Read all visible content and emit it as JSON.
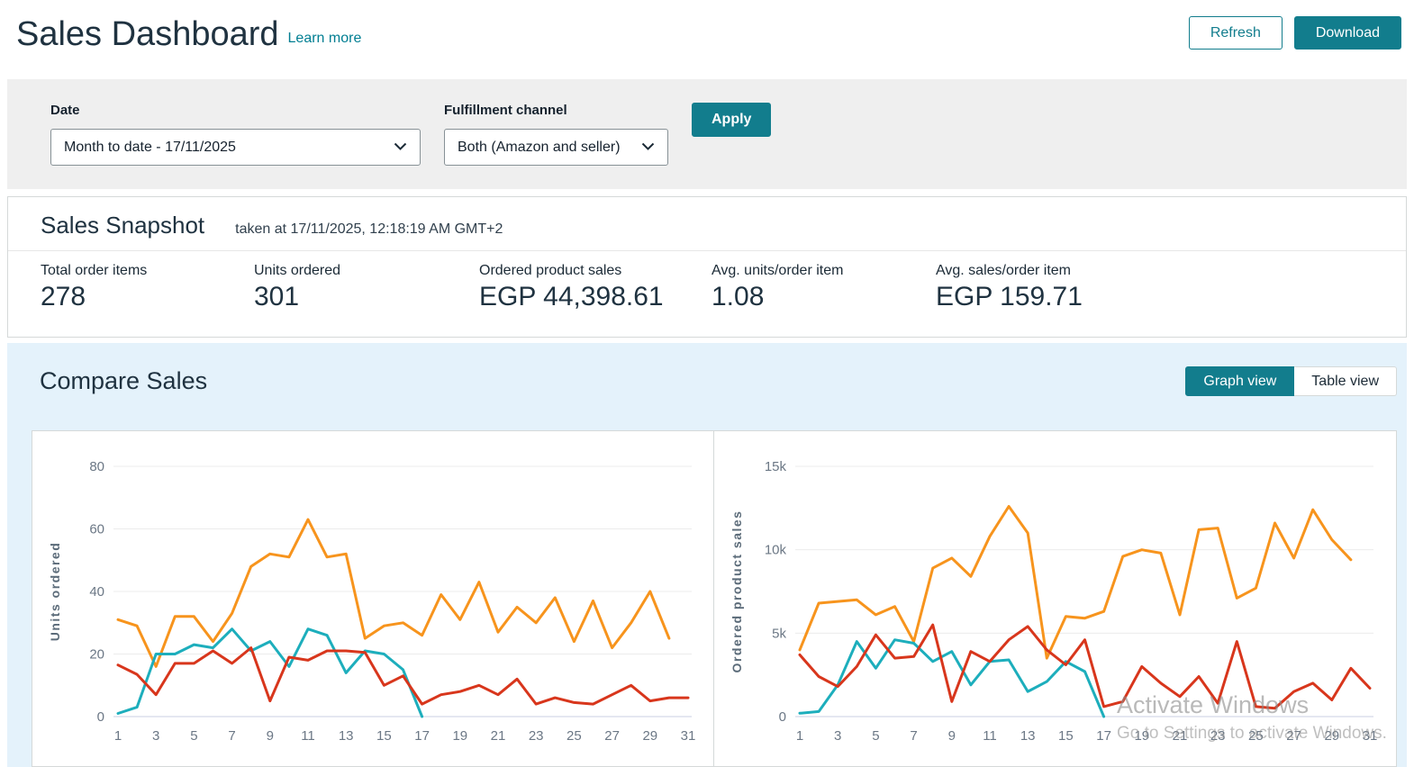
{
  "header": {
    "title": "Sales Dashboard",
    "learn_more": "Learn more",
    "refresh_label": "Refresh",
    "download_label": "Download"
  },
  "filters": {
    "date_label": "Date",
    "date_value": "Month to date - 17/11/2025",
    "channel_label": "Fulfillment channel",
    "channel_value": "Both (Amazon and seller)",
    "apply_label": "Apply"
  },
  "snapshot": {
    "title": "Sales Snapshot",
    "taken_at": "taken at 17/11/2025, 12:18:19 AM GMT+2",
    "metrics": [
      {
        "label": "Total order items",
        "value": "278"
      },
      {
        "label": "Units ordered",
        "value": "301"
      },
      {
        "label": "Ordered product sales",
        "value": "EGP 44,398.61"
      },
      {
        "label": "Avg. units/order item",
        "value": "1.08"
      },
      {
        "label": "Avg. sales/order item",
        "value": "EGP 159.71"
      }
    ]
  },
  "compare": {
    "title": "Compare Sales",
    "graph_view_label": "Graph view",
    "table_view_label": "Table view"
  },
  "watermark": {
    "line1": "Activate Windows",
    "line2": "Go to Settings to activate Windows."
  },
  "colors": {
    "accent_teal": "#127d8d",
    "link_teal": "#007e92",
    "series_orange": "#f7941d",
    "series_teal": "#1daebc",
    "series_red": "#d8361c",
    "compare_bg": "#e4f2fb",
    "filter_bar_bg": "#efefef"
  },
  "chart_data": [
    {
      "type": "line",
      "ylabel": "Units ordered",
      "ylim": [
        0,
        80
      ],
      "xlim": [
        1,
        31
      ],
      "grid": true,
      "legend": "none",
      "yticks": [
        0,
        20,
        40,
        60,
        80
      ],
      "ytick_labels": [
        "0",
        "20",
        "40",
        "60",
        "80"
      ],
      "xticks": [
        1,
        3,
        5,
        7,
        9,
        11,
        13,
        15,
        17,
        19,
        21,
        23,
        25,
        27,
        29,
        31
      ],
      "series": [
        {
          "name": "orange-line",
          "color": "#f7941d",
          "values": [
            31,
            29,
            16,
            32,
            32,
            24,
            33,
            48,
            52,
            51,
            63,
            51,
            52,
            25,
            29,
            30,
            26,
            39,
            31,
            43,
            27,
            35,
            30,
            38,
            24,
            37,
            22,
            30,
            40,
            25
          ]
        },
        {
          "name": "teal-line",
          "color": "#1daebc",
          "values": [
            1,
            3,
            20,
            20,
            23,
            22,
            28,
            21,
            24,
            16,
            28,
            26,
            14,
            21,
            20,
            15,
            0
          ]
        },
        {
          "name": "red-line",
          "color": "#d8361c",
          "values": [
            16.5,
            13.5,
            7,
            17,
            17,
            21,
            17,
            22,
            5,
            19,
            18,
            21,
            21,
            20.5,
            10,
            13,
            4,
            7,
            8,
            10,
            7,
            12,
            4,
            6,
            4.5,
            4,
            7,
            10,
            5,
            6,
            6
          ]
        }
      ]
    },
    {
      "type": "line",
      "ylabel": "Ordered product sales",
      "ylim": [
        0,
        15000
      ],
      "xlim": [
        1,
        31
      ],
      "grid": true,
      "legend": "none",
      "yticks": [
        0,
        5000,
        10000,
        15000
      ],
      "ytick_labels": [
        "0",
        "5k",
        "10k",
        "15k"
      ],
      "xticks": [
        1,
        3,
        5,
        7,
        9,
        11,
        13,
        15,
        17,
        19,
        21,
        23,
        25,
        27,
        29,
        31
      ],
      "series": [
        {
          "name": "orange-line",
          "color": "#f7941d",
          "values": [
            4000,
            6800,
            6900,
            7000,
            6100,
            6600,
            4500,
            8900,
            9500,
            8400,
            10800,
            12600,
            11000,
            3500,
            6000,
            5900,
            6300,
            9600,
            10000,
            9800,
            6100,
            11200,
            11300,
            7100,
            7700,
            11600,
            9500,
            12400,
            10600,
            9400
          ]
        },
        {
          "name": "teal-line",
          "color": "#1daebc",
          "values": [
            200,
            300,
            1900,
            4500,
            2900,
            4600,
            4400,
            3300,
            3900,
            1900,
            3300,
            3400,
            1500,
            2100,
            3300,
            2700,
            0
          ]
        },
        {
          "name": "red-line",
          "color": "#d8361c",
          "values": [
            3700,
            2400,
            1800,
            3000,
            4900,
            3500,
            3600,
            5500,
            900,
            3900,
            3300,
            4600,
            5400,
            4000,
            3100,
            4600,
            600,
            900,
            3000,
            2000,
            1200,
            2400,
            800,
            4500,
            600,
            500,
            1500,
            2000,
            1000,
            2900,
            1700
          ]
        }
      ]
    }
  ]
}
